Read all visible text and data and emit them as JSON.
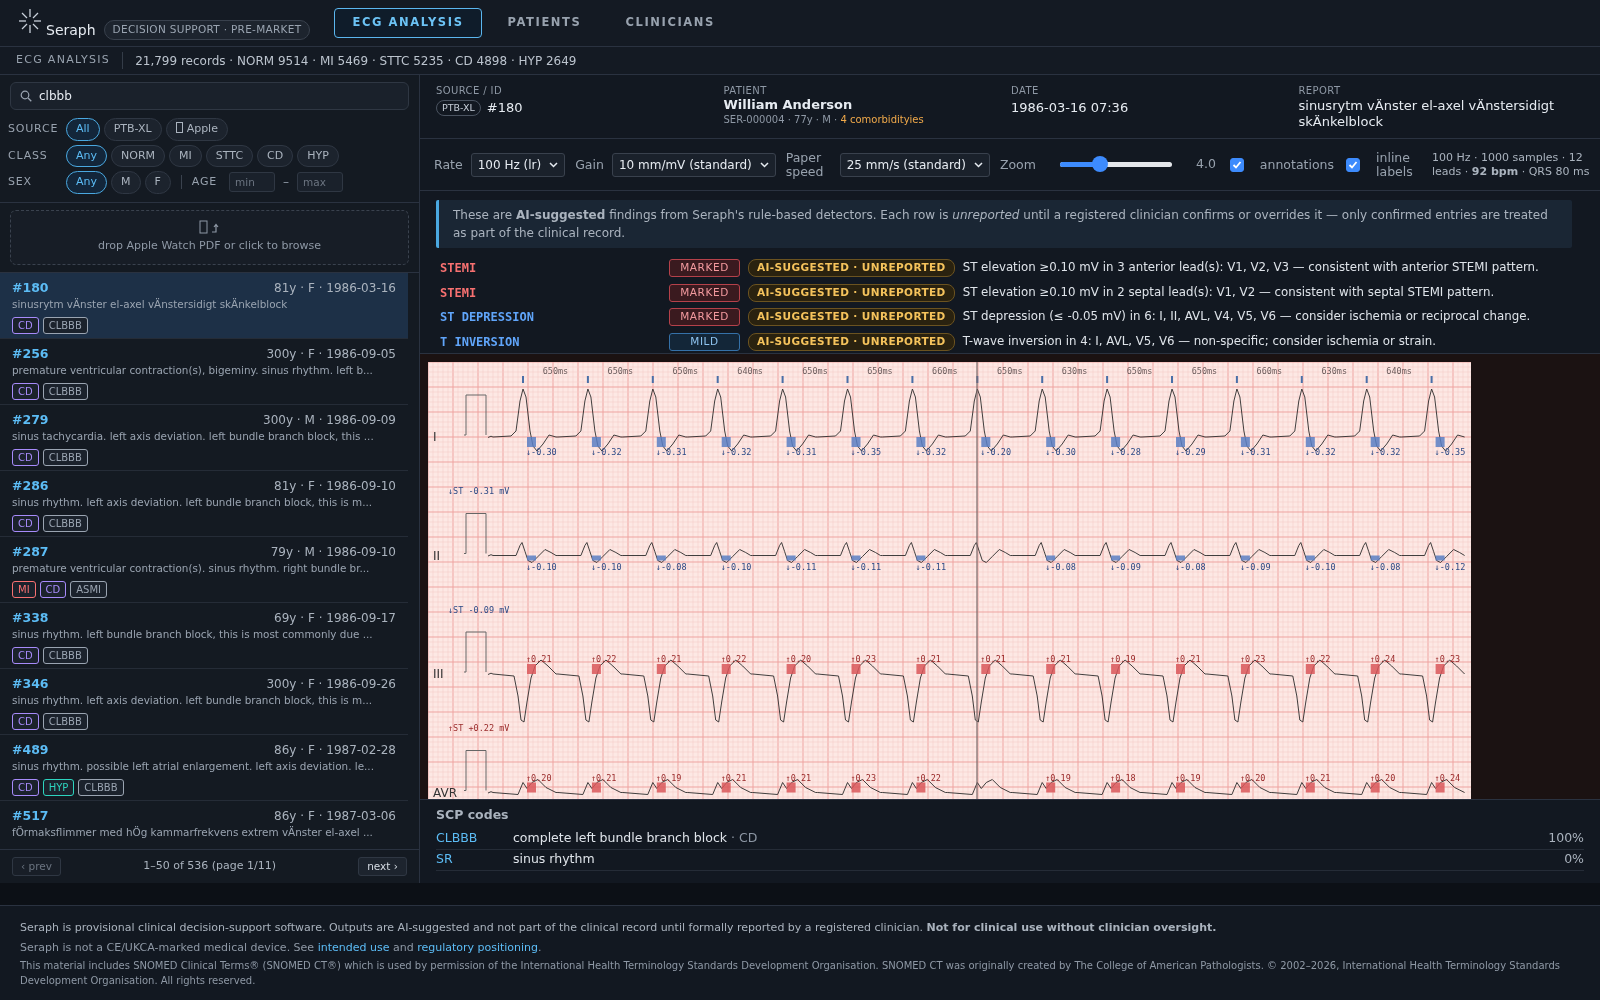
{
  "app": {
    "name": "Seraph",
    "badge": "DECISION SUPPORT · PRE-MARKET"
  },
  "tabs": [
    {
      "label": "ECG ANALYSIS",
      "selected": true
    },
    {
      "label": "PATIENTS",
      "selected": false
    },
    {
      "label": "CLINICIANS",
      "selected": false
    }
  ],
  "subheader": {
    "section": "ECG ANALYSIS",
    "stats": "21,799 records · NORM 9514 · MI 5469 · STTC 5235 · CD 4898 · HYP 2649"
  },
  "sidebar": {
    "search": {
      "value": "clbbb"
    },
    "filters": [
      {
        "label": "SOURCE",
        "options": [
          {
            "label": "All",
            "kind": "text",
            "selected": true
          },
          {
            "label": "PTB-XL",
            "kind": "text",
            "selected": false
          },
          {
            "label": "Apple",
            "kind": "glyph",
            "selected": false
          }
        ]
      },
      {
        "label": "CLASS",
        "options": [
          {
            "label": "Any",
            "kind": "text",
            "selected": true
          },
          {
            "label": "NORM",
            "kind": "text",
            "selected": false
          },
          {
            "label": "MI",
            "kind": "text",
            "selected": false
          },
          {
            "label": "STTC",
            "kind": "text",
            "selected": false
          },
          {
            "label": "CD",
            "kind": "text",
            "selected": false
          },
          {
            "label": "HYP",
            "kind": "text",
            "selected": false
          }
        ]
      },
      {
        "label": "SEX",
        "options": [
          {
            "label": "Any",
            "kind": "text",
            "selected": true
          },
          {
            "label": "M",
            "kind": "text",
            "selected": false
          },
          {
            "label": "F",
            "kind": "text",
            "selected": false
          }
        ]
      }
    ],
    "age": {
      "label": "AGE",
      "min_placeholder": "min",
      "separator": "–",
      "max_placeholder": "max"
    },
    "dropzone": {
      "text": "drop Apple Watch PDF or click to browse"
    },
    "records": [
      {
        "id": "#180",
        "meta": "81y · F · 1986-03-16",
        "summary": "sinusrytm vÄnster el-axel vÄnstersidigt skÄnkelblock",
        "selected": true,
        "tags": [
          {
            "text": "CD",
            "color": "#a78bfa"
          },
          {
            "text": "CLBBB",
            "color": "#9aa4b1"
          }
        ]
      },
      {
        "id": "#256",
        "meta": "300y · F · 1986-09-05",
        "summary": "premature ventricular contraction(s), bigeminy. sinus rhythm. left b...",
        "selected": false,
        "tags": [
          {
            "text": "CD",
            "color": "#a78bfa"
          },
          {
            "text": "CLBBB",
            "color": "#9aa4b1"
          }
        ]
      },
      {
        "id": "#279",
        "meta": "300y · M · 1986-09-09",
        "summary": "sinus tachycardia. left axis deviation. left bundle branch block, this ...",
        "selected": false,
        "tags": [
          {
            "text": "CD",
            "color": "#a78bfa"
          },
          {
            "text": "CLBBB",
            "color": "#9aa4b1"
          }
        ]
      },
      {
        "id": "#286",
        "meta": "81y · F · 1986-09-10",
        "summary": "sinus rhythm. left axis deviation. left bundle branch block, this is m...",
        "selected": false,
        "tags": [
          {
            "text": "CD",
            "color": "#a78bfa"
          },
          {
            "text": "CLBBB",
            "color": "#9aa4b1"
          }
        ]
      },
      {
        "id": "#287",
        "meta": "79y · M · 1986-09-10",
        "summary": "premature ventricular contraction(s). sinus rhythm. right bundle br...",
        "selected": false,
        "tags": [
          {
            "text": "MI",
            "color": "#f87171"
          },
          {
            "text": "CD",
            "color": "#a78bfa"
          },
          {
            "text": "ASMI",
            "color": "#9aa4b1"
          }
        ]
      },
      {
        "id": "#338",
        "meta": "69y · F · 1986-09-17",
        "summary": "sinus rhythm. left bundle branch block, this is most commonly due ...",
        "selected": false,
        "tags": [
          {
            "text": "CD",
            "color": "#a78bfa"
          },
          {
            "text": "CLBBB",
            "color": "#9aa4b1"
          }
        ]
      },
      {
        "id": "#346",
        "meta": "300y · F · 1986-09-26",
        "summary": "sinus rhythm. left axis deviation. left bundle branch block, this is m...",
        "selected": false,
        "tags": [
          {
            "text": "CD",
            "color": "#a78bfa"
          },
          {
            "text": "CLBBB",
            "color": "#9aa4b1"
          }
        ]
      },
      {
        "id": "#489",
        "meta": "86y · F · 1987-02-28",
        "summary": "sinus rhythm. possible left atrial enlargement. left axis deviation. le...",
        "selected": false,
        "tags": [
          {
            "text": "CD",
            "color": "#a78bfa"
          },
          {
            "text": "HYP",
            "color": "#2dd4bf"
          },
          {
            "text": "CLBBB",
            "color": "#9aa4b1"
          }
        ]
      },
      {
        "id": "#517",
        "meta": "86y · F · 1987-03-06",
        "summary": "fÖrmaksflimmer med hÖg kammarfrekvens extrem vÄnster el-axel ...",
        "selected": false
      }
    ],
    "pagination": {
      "prev": "‹ prev",
      "prev_disabled": true,
      "range": "1–50 of 536 (page 1/11)",
      "next": "next ›"
    }
  },
  "patient": {
    "source_label": "SOURCE / ID",
    "source": "PTB-XL",
    "id": "#180",
    "patient_label": "PATIENT",
    "name": "William Anderson",
    "details": "SER-000004 · 77y · M ·",
    "comorbidities": "4 comorbidityies",
    "date_label": "DATE",
    "date": "1986-03-16 07:36",
    "report_label": "REPORT",
    "report": "sinusrytm vÄnster el-axel vÄnstersidigt skÄnkelblock"
  },
  "controls": [
    {
      "kind": "select",
      "label": "Rate",
      "value": "100 Hz (lr)"
    },
    {
      "kind": "select",
      "label": "Gain",
      "value": "10 mm/mV (standard)"
    },
    {
      "kind": "select",
      "label": "Paper speed",
      "value": "25 mm/s (standard)"
    },
    {
      "kind": "slider",
      "label": "Zoom",
      "level": 0.36,
      "reading": "4.0"
    },
    {
      "kind": "checkbox",
      "label": "annotations",
      "checked": true
    },
    {
      "kind": "checkbox",
      "label": "inline labels",
      "checked": true
    }
  ],
  "signal_info": "100 Hz · 1000 samples · 12 leads · **92 bpm** · QRS 80 ms",
  "findings": {
    "notice": "These are **AI-suggested** findings from Seraph's rule-based detectors. Each row is *unreported* until a registered clinician confirms or overrides it — only confirmed entries are treated as part of the clinical record.",
    "rows": [
      {
        "name": "STEMI",
        "color": "#f87171",
        "severity": "MARKED",
        "kind": "marked",
        "status": "AI-SUGGESTED · UNREPORTED",
        "text": "ST elevation ≥0.10 mV in 3 anterior lead(s): V1, V2, V3 — consistent with anterior STEMI pattern."
      },
      {
        "name": "STEMI",
        "color": "#f87171",
        "severity": "MARKED",
        "kind": "marked",
        "status": "AI-SUGGESTED · UNREPORTED",
        "text": "ST elevation ≥0.10 mV in 2 septal lead(s): V1, V2 — consistent with septal STEMI pattern."
      },
      {
        "name": "ST DEPRESSION",
        "color": "#60a5fa",
        "severity": "MARKED",
        "kind": "marked",
        "status": "AI-SUGGESTED · UNREPORTED",
        "text": "ST depression (≤ -0.05 mV) in 6: I, II, AVL, V4, V5, V6 — consider ischemia or reciprocal change."
      },
      {
        "name": "T INVERSION",
        "color": "#60a5fa",
        "severity": "MILD",
        "kind": "mild",
        "status": "AI-SUGGESTED · UNREPORTED",
        "text": "T-wave inversion in 4: I, AVL, V5, V6 — non-specific; consider ischemia or strain."
      }
    ]
  },
  "ecg": {
    "intervals": [
      "650ms",
      "650ms",
      "650ms",
      "640ms",
      "650ms",
      "650ms",
      "660ms",
      "650ms",
      "630ms",
      "650ms",
      "650ms",
      "660ms",
      "630ms",
      "640ms"
    ],
    "leads": [
      {
        "name": "I",
        "kind": "depression",
        "summary": "↓ST -0.31 mV",
        "beats": [
          {
            "kind": "labeled",
            "label": "↓-0.30"
          },
          {
            "kind": "labeled",
            "label": "↓-0.32"
          },
          {
            "kind": "labeled",
            "label": "↓-0.31"
          },
          {
            "kind": "labeled",
            "label": "↓-0.32"
          },
          {
            "kind": "labeled",
            "label": "↓-0.31"
          },
          {
            "kind": "labeled",
            "label": "↓-0.35"
          },
          {
            "kind": "labeled",
            "label": "↓-0.32"
          },
          {
            "kind": "labeled",
            "label": "↓-0.20"
          },
          {
            "kind": "labeled",
            "label": "↓-0.30"
          },
          {
            "kind": "labeled",
            "label": "↓-0.28"
          },
          {
            "kind": "labeled",
            "label": "↓-0.29"
          },
          {
            "kind": "labeled",
            "label": "↓-0.31"
          },
          {
            "kind": "labeled",
            "label": "↓-0.32"
          },
          {
            "kind": "labeled",
            "label": "↓-0.32"
          },
          {
            "kind": "labeled",
            "label": "↓-0.35"
          }
        ]
      },
      {
        "name": "II",
        "kind": "depression",
        "summary": "↓ST -0.09 mV",
        "beats": [
          {
            "kind": "labeled",
            "label": "↓-0.10"
          },
          {
            "kind": "labeled",
            "label": "↓-0.10"
          },
          {
            "kind": "labeled",
            "label": "↓-0.08"
          },
          {
            "kind": "labeled",
            "label": "↓-0.10"
          },
          {
            "kind": "labeled",
            "label": "↓-0.11"
          },
          {
            "kind": "labeled",
            "label": "↓-0.11"
          },
          {
            "kind": "labeled",
            "label": "↓-0.11"
          },
          {
            "kind": "unlabeled"
          },
          {
            "kind": "labeled",
            "label": "↓-0.08"
          },
          {
            "kind": "labeled",
            "label": "↓-0.09"
          },
          {
            "kind": "labeled",
            "label": "↓-0.08"
          },
          {
            "kind": "labeled",
            "label": "↓-0.09"
          },
          {
            "kind": "labeled",
            "label": "↓-0.10"
          },
          {
            "kind": "labeled",
            "label": "↓-0.08"
          },
          {
            "kind": "labeled",
            "label": "↓-0.12"
          }
        ]
      },
      {
        "name": "III",
        "kind": "elevation",
        "summary": "↑ST +0.22 mV",
        "beats": [
          {
            "kind": "labeled",
            "label": "↑0.21"
          },
          {
            "kind": "labeled",
            "label": "↑0.22"
          },
          {
            "kind": "labeled",
            "label": "↑0.21"
          },
          {
            "kind": "labeled",
            "label": "↑0.22"
          },
          {
            "kind": "labeled",
            "label": "↑0.20"
          },
          {
            "kind": "labeled",
            "label": "↑0.23"
          },
          {
            "kind": "labeled",
            "label": "↑0.21"
          },
          {
            "kind": "labeled",
            "label": "↑0.21"
          },
          {
            "kind": "labeled",
            "label": "↑0.21"
          },
          {
            "kind": "labeled",
            "label": "↑0.19"
          },
          {
            "kind": "labeled",
            "label": "↑0.21"
          },
          {
            "kind": "labeled",
            "label": "↑0.23"
          },
          {
            "kind": "labeled",
            "label": "↑0.22"
          },
          {
            "kind": "labeled",
            "label": "↑0.24"
          },
          {
            "kind": "labeled",
            "label": "↑0.23"
          }
        ]
      },
      {
        "name": "AVR",
        "kind": "elevation",
        "beats": [
          {
            "kind": "labeled",
            "label": "↑0.20"
          },
          {
            "kind": "labeled",
            "label": "↑0.21"
          },
          {
            "kind": "labeled",
            "label": "↑0.19"
          },
          {
            "kind": "labeled",
            "label": "↑0.21"
          },
          {
            "kind": "labeled",
            "label": "↑0.21"
          },
          {
            "kind": "labeled",
            "label": "↑0.23"
          },
          {
            "kind": "labeled",
            "label": "↑0.22"
          },
          {
            "kind": "unlabeled"
          },
          {
            "kind": "labeled",
            "label": "↑0.19"
          },
          {
            "kind": "labeled",
            "label": "↑0.18"
          },
          {
            "kind": "labeled",
            "label": "↑0.19"
          },
          {
            "kind": "labeled",
            "label": "↑0.20"
          },
          {
            "kind": "labeled",
            "label": "↑0.21"
          },
          {
            "kind": "labeled",
            "label": "↑0.20"
          },
          {
            "kind": "labeled",
            "label": "↑0.24"
          }
        ]
      }
    ]
  },
  "scp": {
    "title": "SCP codes",
    "codes": [
      {
        "code": "CLBBB",
        "description": "complete left bundle branch block",
        "class": "· CD",
        "confidence": "100%"
      },
      {
        "code": "SR",
        "description": "sinus rhythm",
        "confidence": "0%"
      }
    ]
  },
  "footer": {
    "notice": "Seraph is provisional clinical decision-support software. Outputs are AI-suggested and not part of the clinical record until formally reported by a registered clinician. **Not for clinical use without clinician oversight.**",
    "regulatory": [
      {
        "kind": "text",
        "text": "Seraph is not a CE/UKCA-marked medical device. See "
      },
      {
        "kind": "link",
        "text": "intended use"
      },
      {
        "kind": "text",
        "text": " and "
      },
      {
        "kind": "link",
        "text": "regulatory positioning"
      },
      {
        "kind": "text",
        "text": "."
      }
    ],
    "license": "This material includes SNOMED Clinical Terms® (SNOMED CT®) which is used by permission of the International Health Terminology Standards Development Organisation. SNOMED CT was originally created by The College of American Pathologists. © 2002–2026, International Health Terminology Standards Development Organisation. All rights reserved."
  }
}
